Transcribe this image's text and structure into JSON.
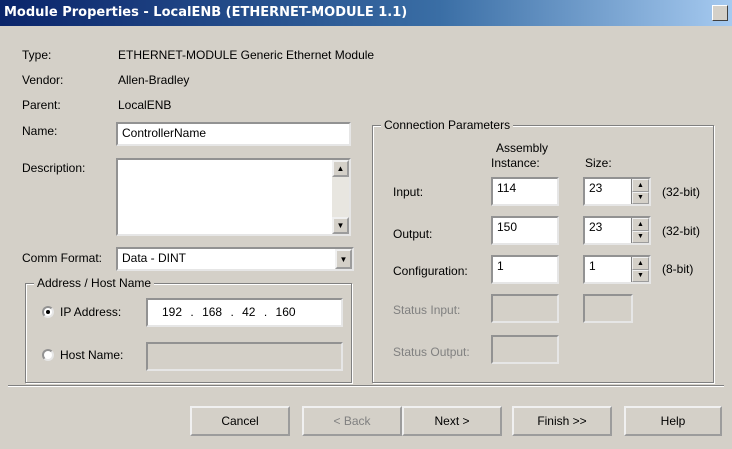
{
  "window": {
    "title": "Module Properties  - LocalENB (ETHERNET-MODULE 1.1)"
  },
  "info": {
    "type_label": "Type:",
    "type_value": "ETHERNET-MODULE Generic Ethernet Module",
    "vendor_label": "Vendor:",
    "vendor_value": "Allen-Bradley",
    "parent_label": "Parent:",
    "parent_value": "LocalENB",
    "name_label": "Name:",
    "name_value": "ControllerName",
    "description_label": "Description:",
    "description_value": "",
    "comm_format_label": "Comm Format:",
    "comm_format_value": "Data - DINT"
  },
  "address": {
    "group_label": "Address / Host Name",
    "ip_label": "IP Address:",
    "ip": [
      "192",
      "168",
      "42",
      "160"
    ],
    "host_label": "Host Name:",
    "host_value": "",
    "selected": "ip"
  },
  "connection": {
    "group_label": "Connection Parameters",
    "col_assembly_line1": "Assembly",
    "col_assembly_line2": "Instance:",
    "col_size": "Size:",
    "input_label": "Input:",
    "input_instance": "114",
    "input_size": "23",
    "input_unit": "(32-bit)",
    "output_label": "Output:",
    "output_instance": "150",
    "output_size": "23",
    "output_unit": "(32-bit)",
    "config_label": "Configuration:",
    "config_instance": "1",
    "config_size": "1",
    "config_unit": "(8-bit)",
    "status_input_label": "Status Input:",
    "status_output_label": "Status Output:"
  },
  "buttons": {
    "cancel": "Cancel",
    "back": "< Back",
    "next": "Next >",
    "finish": "Finish >>",
    "help": "Help"
  }
}
